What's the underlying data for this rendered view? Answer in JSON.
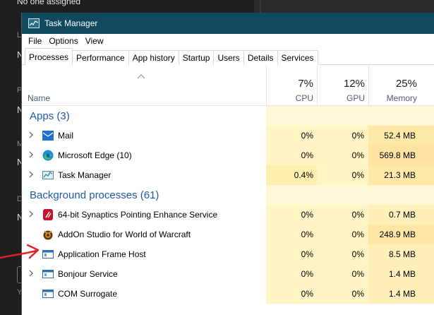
{
  "background": {
    "top_text": "No one assigned",
    "side_letters": [
      "L",
      "N",
      "P",
      "N",
      "M",
      "N",
      "D",
      "N",
      "Y"
    ]
  },
  "window": {
    "title": "Task Manager",
    "menu": [
      "File",
      "Options",
      "View"
    ],
    "tabs": [
      "Processes",
      "Performance",
      "App history",
      "Startup",
      "Users",
      "Details",
      "Services"
    ],
    "active_tab": "Processes"
  },
  "columns": {
    "name": "Name",
    "cpu": {
      "pct": "7%",
      "label": "CPU"
    },
    "gpu": {
      "pct": "12%",
      "label": "GPU"
    },
    "memory": {
      "pct": "25%",
      "label": "Memory"
    }
  },
  "groups": {
    "apps": {
      "title": "Apps (3)",
      "rows": [
        {
          "name": "Mail",
          "icon": "mail-icon",
          "cpu": "0%",
          "gpu": "0%",
          "memory": "52.4 MB",
          "expandable": true
        },
        {
          "name": "Microsoft Edge (10)",
          "icon": "edge-icon",
          "cpu": "0%",
          "gpu": "0%",
          "memory": "569.8 MB",
          "expandable": true
        },
        {
          "name": "Task Manager",
          "icon": "task-manager-icon",
          "cpu": "0.4%",
          "gpu": "0%",
          "memory": "21.3 MB",
          "expandable": true
        }
      ]
    },
    "background": {
      "title": "Background processes (61)",
      "rows": [
        {
          "name": "64-bit Synaptics Pointing Enhance Service",
          "icon": "synaptics-icon",
          "cpu": "0%",
          "gpu": "0%",
          "memory": "0.7 MB",
          "expandable": true
        },
        {
          "name": "AddOn Studio for World of Warcraft",
          "icon": "addon-studio-icon",
          "cpu": "0%",
          "gpu": "0%",
          "memory": "248.9 MB",
          "expandable": false
        },
        {
          "name": "Application Frame Host",
          "icon": "window-icon",
          "cpu": "0%",
          "gpu": "0%",
          "memory": "8.5 MB",
          "expandable": false
        },
        {
          "name": "Bonjour Service",
          "icon": "window-icon",
          "cpu": "0%",
          "gpu": "0%",
          "memory": "1.4 MB",
          "expandable": true
        },
        {
          "name": "COM Surrogate",
          "icon": "window-icon",
          "cpu": "0%",
          "gpu": "0%",
          "memory": "1.4 MB",
          "expandable": false
        }
      ]
    }
  },
  "colors": {
    "titlebar": "#114a5e",
    "cpu_gpu_heat": "#fff4c4",
    "memory_heat": "#ffe9a8",
    "group_title": "#1e5aa8",
    "annotation_arrow": "#e0202a"
  }
}
